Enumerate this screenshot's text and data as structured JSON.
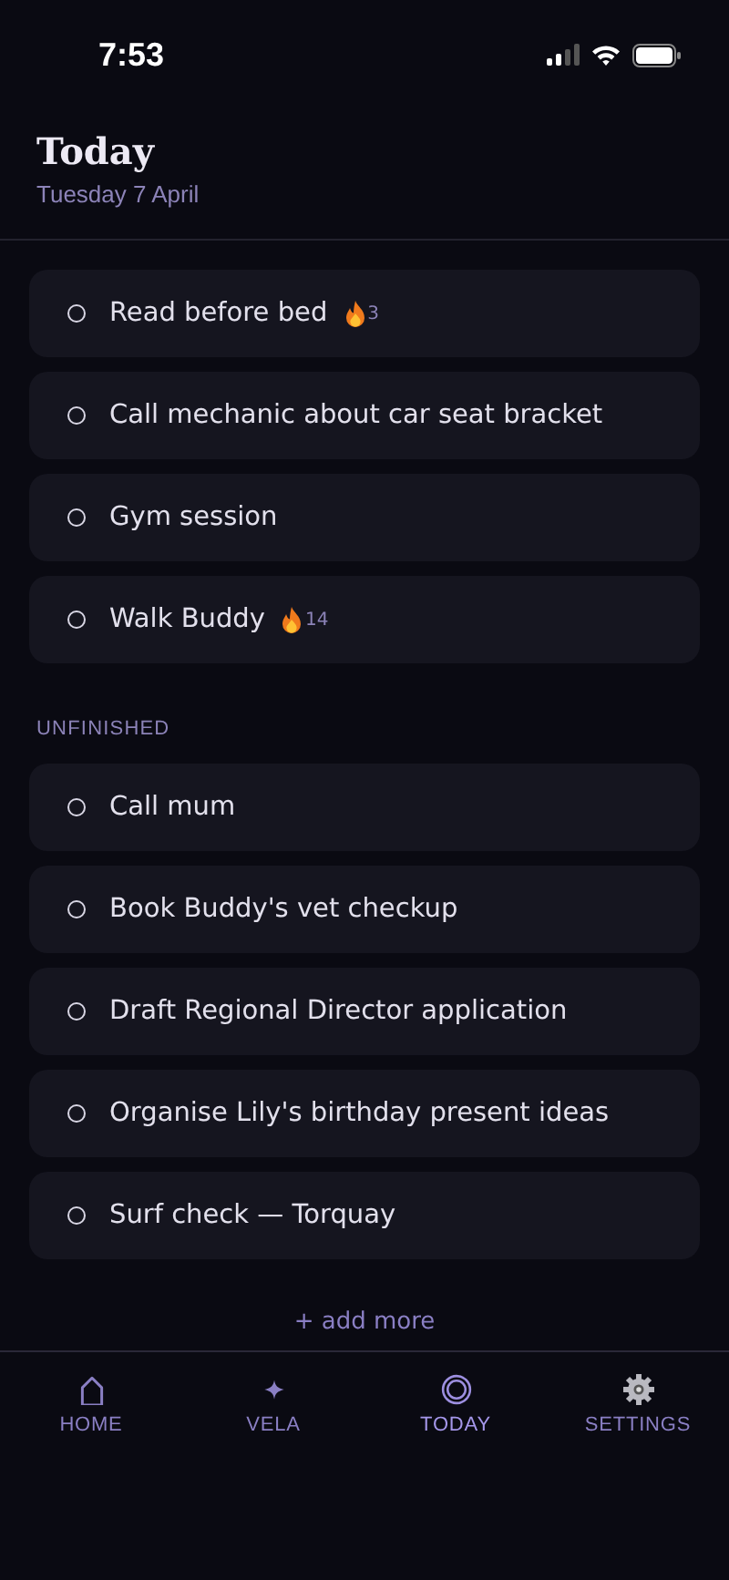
{
  "status_bar": {
    "time": "7:53"
  },
  "header": {
    "title": "Today",
    "date": "Tuesday 7 April"
  },
  "sections": [
    {
      "tasks": [
        {
          "text": "Read before bed",
          "done": false,
          "streak": "3"
        },
        {
          "text": "Call mechanic about car seat bracket",
          "done": false
        },
        {
          "text": "Gym session",
          "done": false
        },
        {
          "text": "Walk Buddy",
          "done": false,
          "streak": "14"
        }
      ]
    },
    {
      "label": "UNFINISHED",
      "tasks": [
        {
          "text": "Call mum",
          "done": false
        },
        {
          "text": "Book Buddy's vet checkup",
          "done": false
        },
        {
          "text": "Draft Regional Director application",
          "done": false
        },
        {
          "text": "Organise Lily's birthday present ideas",
          "done": false
        },
        {
          "text": "Surf check — Torquay",
          "done": false
        }
      ]
    }
  ],
  "add_more": "+ add more",
  "nav": [
    {
      "kind": "home",
      "label": "HOME",
      "selected": false
    },
    {
      "kind": "sparkle",
      "label": "VELA",
      "selected": false
    },
    {
      "kind": "rings",
      "label": "TODAY",
      "selected": true
    },
    {
      "kind": "gear",
      "label": "SETTINGS",
      "selected": false
    }
  ]
}
